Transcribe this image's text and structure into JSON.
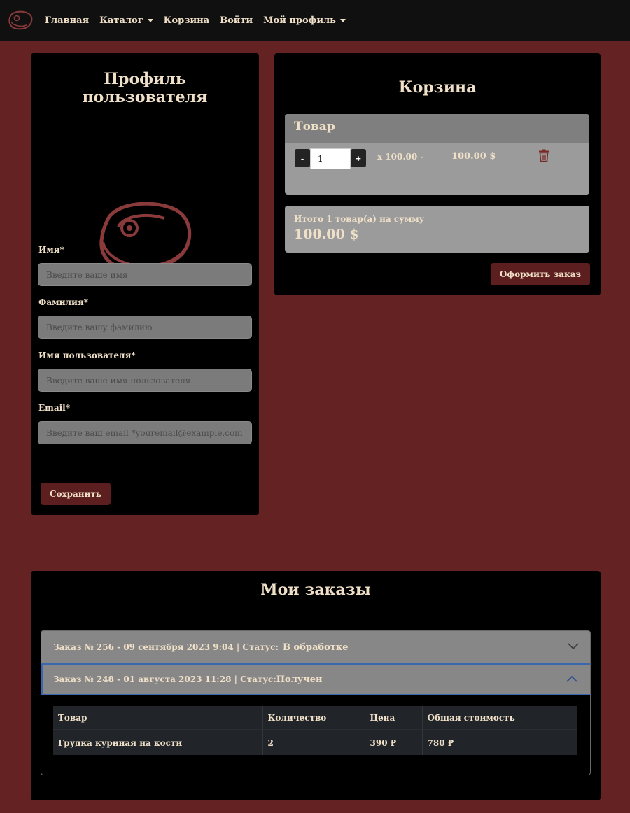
{
  "navbar": {
    "logo_icon": "steak-icon",
    "items": [
      {
        "label": "Главная",
        "dropdown": false
      },
      {
        "label": "Каталог",
        "dropdown": true
      },
      {
        "label": "Корзина",
        "dropdown": false
      },
      {
        "label": "Войти",
        "dropdown": false
      },
      {
        "label": "Мой профиль",
        "dropdown": true
      }
    ]
  },
  "profile": {
    "title_line1": "Профиль",
    "title_line2": "пользователя",
    "image_icon": "steak-icon",
    "fields": [
      {
        "label": "Имя*",
        "placeholder": "Введите ваше имя",
        "value": ""
      },
      {
        "label": "Фамилия*",
        "placeholder": "Введите вашу фамилию",
        "value": ""
      },
      {
        "label": "Имя пользователя*",
        "placeholder": "Введите ваше имя пользователя",
        "value": ""
      },
      {
        "label": "Email*",
        "placeholder": "Введите ваш email *youremail@example.com",
        "value": ""
      }
    ],
    "save_label": "Сохранить"
  },
  "cart": {
    "title": "Корзина",
    "column_header": "Товар",
    "items": [
      {
        "quantity": "1",
        "unit_price": "x 100.00 -",
        "sum": "100.00 $"
      }
    ],
    "total_label": "Итого 1 товар(а) на сумму",
    "total_value": "100.00 $",
    "checkout_label": "Оформить заказ"
  },
  "orders": {
    "title": "Мои заказы",
    "list": [
      {
        "header": "Заказ № 256 - 09 сентября 2023 9:04 | Статус:",
        "status": "В обработке",
        "expanded": false
      },
      {
        "header": "Заказ № 248 - 01 августа 2023 11:28 | Статус:",
        "status": "Получен",
        "expanded": true
      }
    ],
    "table": {
      "columns": [
        "Товар",
        "Количество",
        "Цена",
        "Общая стоимость"
      ],
      "rows": [
        [
          "Грудка куриная на кости",
          "2",
          "390 ₽",
          "780 ₽"
        ]
      ]
    }
  },
  "colors": {
    "page_background": "#652222",
    "accent": "#5c1e1e",
    "icon": "#8a3a3a",
    "text": "#f0e0c8"
  }
}
